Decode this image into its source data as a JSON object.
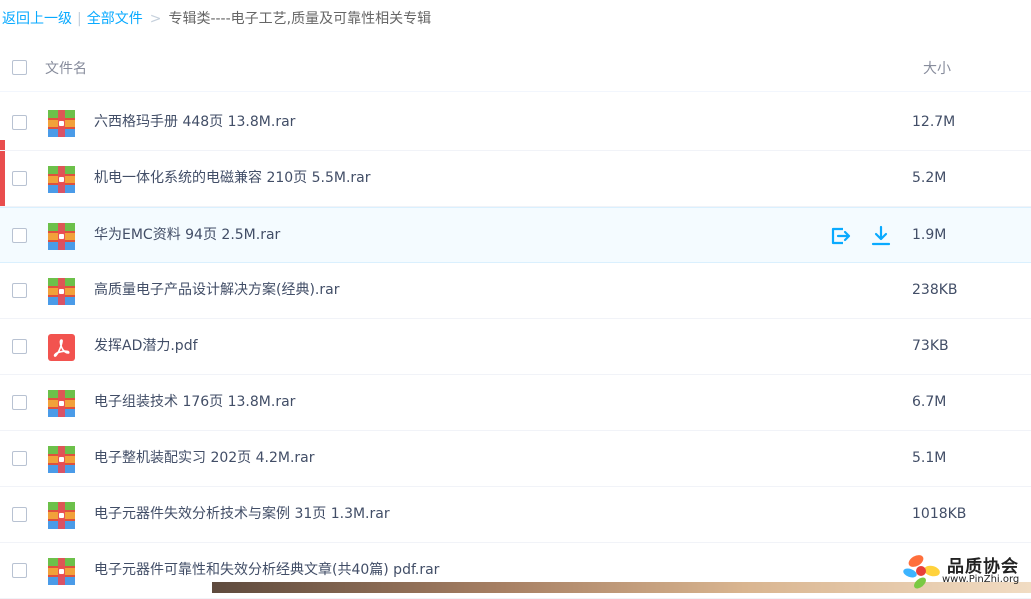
{
  "breadcrumb": {
    "back_label": "返回上一级",
    "separator": "|",
    "all_files_label": "全部文件",
    "arrow": ">",
    "current_label": "专辑类----电子工艺,质量及可靠性相关专辑"
  },
  "header": {
    "name_label": "文件名",
    "size_label": "大小"
  },
  "files": [
    {
      "name": "六西格玛手册 448页 13.8M.rar",
      "size": "12.7M",
      "type": "rar-icon"
    },
    {
      "name": "机电一体化系统的电磁兼容 210页 5.5M.rar",
      "size": "5.2M",
      "type": "rar-icon"
    },
    {
      "name": "华为EMC资料 94页 2.5M.rar",
      "size": "1.9M",
      "type": "rar-icon",
      "hovered": true
    },
    {
      "name": "高质量电子产品设计解决方案(经典).rar",
      "size": "238KB",
      "type": "rar-icon"
    },
    {
      "name": "发挥AD潜力.pdf",
      "size": "73KB",
      "type": "pdf-icon"
    },
    {
      "name": "电子组装技术 176页 13.8M.rar",
      "size": "6.7M",
      "type": "rar-icon"
    },
    {
      "name": "电子整机装配实习 202页 4.2M.rar",
      "size": "5.1M",
      "type": "rar-icon"
    },
    {
      "name": "电子元器件失效分析技术与案例 31页 1.3M.rar",
      "size": "1018KB",
      "type": "rar-icon"
    },
    {
      "name": "电子元器件可靠性和失效分析经典文章(共40篇) pdf.rar",
      "size": "",
      "type": "rar-icon"
    }
  ],
  "row_actions": {
    "share_icon": "share-icon",
    "download_icon": "download-icon"
  },
  "watermark": {
    "brand": "品质协会",
    "url": "www.PinZhi.org"
  },
  "colors": {
    "link": "#09aaff",
    "hover_row": "#f4fbff",
    "text": "#424e67",
    "pdf_red": "#f2534f",
    "side_tab": "#e94d4d"
  }
}
